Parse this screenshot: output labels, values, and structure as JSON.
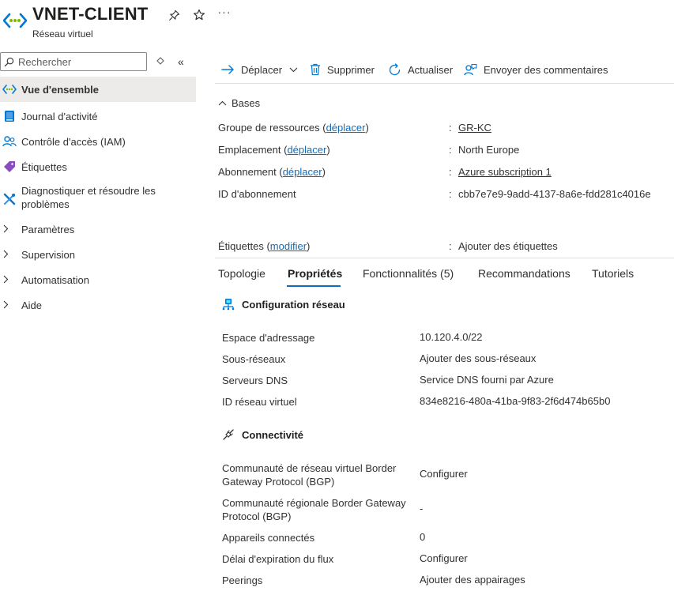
{
  "header": {
    "title": "VNET-CLIENT",
    "subtitle": "Réseau virtuel",
    "more_label": "···"
  },
  "sidebar": {
    "search_placeholder": "Rechercher",
    "collapse_label": "«",
    "items": [
      {
        "label": "Vue d'ensemble",
        "icon": "vnet-icon",
        "selected": true
      },
      {
        "label": "Journal d'activité",
        "icon": "activity-log-icon"
      },
      {
        "label": "Contrôle d'accès (IAM)",
        "icon": "iam-icon"
      },
      {
        "label": "Étiquettes",
        "icon": "tag-icon"
      },
      {
        "label": "Diagnostiquer et résoudre les problèmes",
        "icon": "wrench-icon"
      },
      {
        "label": "Paramètres",
        "expandable": true
      },
      {
        "label": "Supervision",
        "expandable": true
      },
      {
        "label": "Automatisation",
        "expandable": true
      },
      {
        "label": "Aide",
        "expandable": true
      }
    ]
  },
  "toolbar": {
    "move": "Déplacer",
    "delete": "Supprimer",
    "refresh": "Actualiser",
    "feedback": "Envoyer des commentaires"
  },
  "essentials": {
    "section": "Bases",
    "rows": [
      {
        "label": "Groupe de ressources",
        "action": "déplacer",
        "value": "GR-KC",
        "value_link": true
      },
      {
        "label": "Emplacement",
        "action": "déplacer",
        "value": "North Europe",
        "value_link": false
      },
      {
        "label": "Abonnement",
        "action": "déplacer",
        "value": "Azure subscription 1",
        "value_link": true
      },
      {
        "label": "ID d'abonnement",
        "action": "",
        "value": "cbb7e7e9-9add-4137-8a6e-fdd281c4016e",
        "value_link": false
      }
    ],
    "tags": {
      "label": "Étiquettes",
      "action": "modifier",
      "value": "Ajouter des étiquettes"
    }
  },
  "tabs": [
    "Topologie",
    "Propriétés",
    "Fonctionnalités (5)",
    "Recommandations",
    "Tutoriels"
  ],
  "active_tab": "Propriétés",
  "network_config": {
    "title": "Configuration réseau",
    "rows": [
      {
        "label": "Espace d'adressage",
        "value": "10.120.4.0/22",
        "link": true
      },
      {
        "label": "Sous-réseaux",
        "value": "Ajouter des sous-réseaux",
        "link": true
      },
      {
        "label": "Serveurs DNS",
        "value": "Service DNS fourni par Azure",
        "link": true
      },
      {
        "label": "ID réseau virtuel",
        "value": "834e8216-480a-41ba-9f83-2f6d474b65b0",
        "link": false
      }
    ]
  },
  "connectivity": {
    "title": "Connectivité",
    "rows": [
      {
        "label": "Communauté de réseau virtuel Border Gateway Protocol (BGP)",
        "value": "Configurer",
        "link": true
      },
      {
        "label": "Communauté régionale Border Gateway Protocol (BGP)",
        "value": "-",
        "link": false
      },
      {
        "label": "Appareils connectés",
        "value": "0",
        "link": true
      },
      {
        "label": "Délai d'expiration du flux",
        "value": "Configurer",
        "link": true
      },
      {
        "label": "Peerings",
        "value": "Ajouter des appairages",
        "link": true
      }
    ]
  },
  "colors": {
    "accent": "#0f6cbd",
    "selected_bg": "#edebe9",
    "divider": "#e1dfdd"
  }
}
